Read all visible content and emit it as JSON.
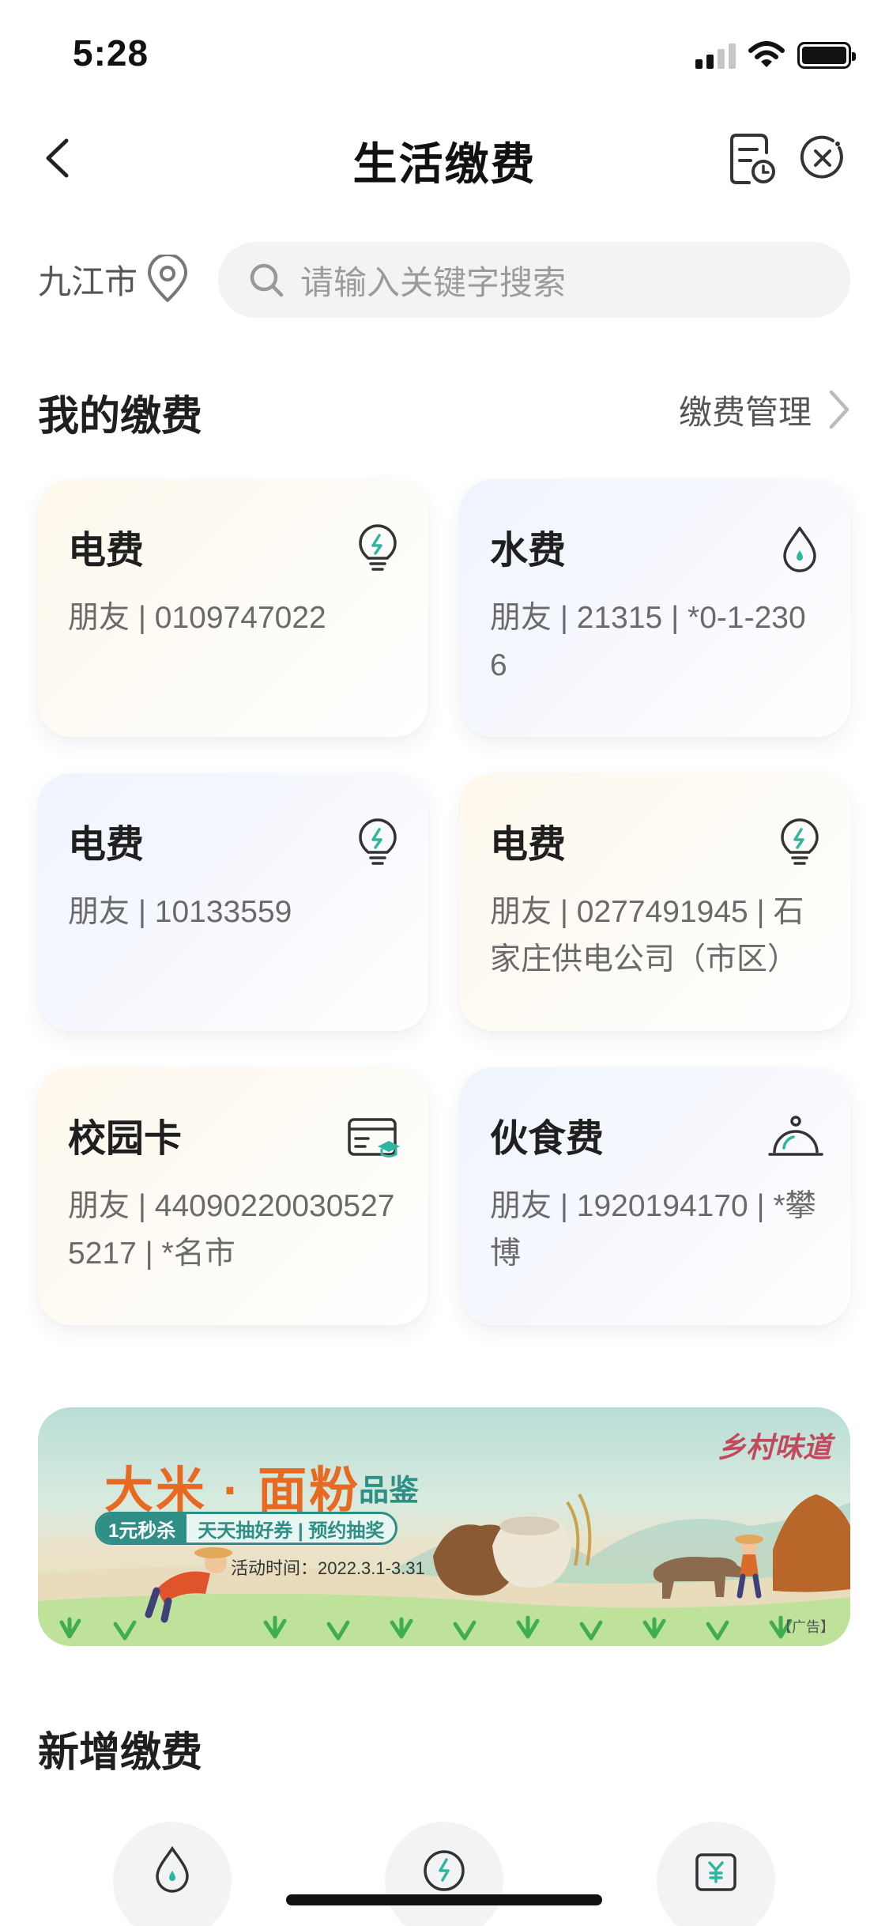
{
  "status_bar": {
    "time": "5:28"
  },
  "nav": {
    "title": "生活缴费"
  },
  "location": {
    "city": "九江市"
  },
  "search": {
    "placeholder": "请输入关键字搜索"
  },
  "my_payments": {
    "title": "我的缴费",
    "manage_label": "缴费管理",
    "cards": [
      {
        "title": "电费",
        "detail": "朋友 | 0109747022",
        "icon": "lightbulb-icon"
      },
      {
        "title": "水费",
        "detail": "朋友 | 21315 | *0-1-2306",
        "icon": "water-drop-icon"
      },
      {
        "title": "电费",
        "detail": "朋友 | 10133559",
        "icon": "lightbulb-icon"
      },
      {
        "title": "电费",
        "detail": "朋友 | 0277491945 | 石家庄供电公司（市区）",
        "icon": "lightbulb-icon"
      },
      {
        "title": "校园卡",
        "detail": "朋友 | 440902200305275217 | *名市",
        "icon": "campus-card-icon"
      },
      {
        "title": "伙食费",
        "detail": "朋友 | 1920194170 | *攀博",
        "icon": "meal-cloche-icon"
      }
    ]
  },
  "banner": {
    "title": "大米 · 面粉",
    "title_suffix": "品鉴",
    "tag": "1元秒杀",
    "promo": "天天抽好券 | 预约抽奖",
    "date": "活动时间：2022.3.1-3.31",
    "brand": "乡村味道",
    "ad_label": "【广告】"
  },
  "add_payment": {
    "title": "新增缴费",
    "icons": [
      "water-drop-icon",
      "electricity-icon",
      "payment-card-icon"
    ]
  },
  "colors": {
    "accent": "#2fb5a0",
    "banner_orange": "#e86a22",
    "banner_teal": "#2f8f86"
  }
}
